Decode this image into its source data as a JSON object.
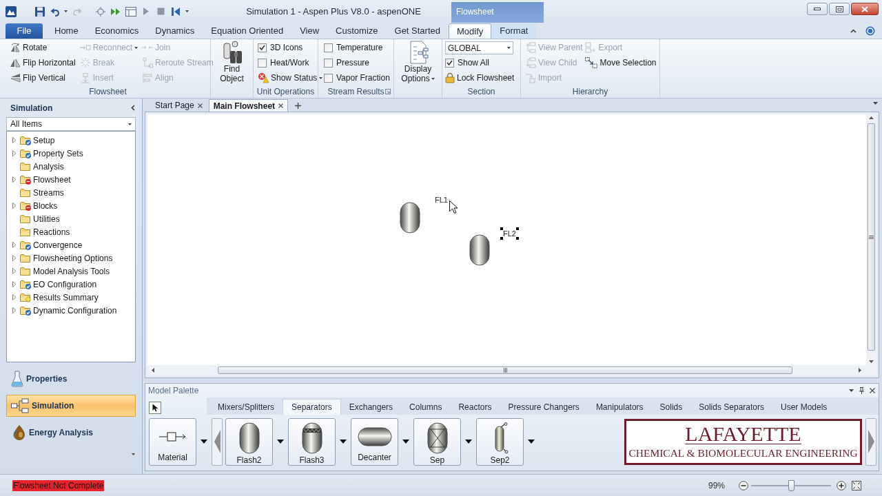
{
  "window": {
    "title": "Simulation 1 - Aspen Plus V8.0 - aspenONE",
    "context_tab": "Flowsheet"
  },
  "ribbon_tabs": [
    {
      "label": "File",
      "kind": "file",
      "selected": false
    },
    {
      "label": "Home",
      "kind": "tab",
      "selected": false
    },
    {
      "label": "Economics",
      "kind": "tab",
      "selected": false
    },
    {
      "label": "Dynamics",
      "kind": "tab",
      "selected": false
    },
    {
      "label": "Equation Oriented",
      "kind": "tab",
      "selected": false
    },
    {
      "label": "View",
      "kind": "tab",
      "selected": false
    },
    {
      "label": "Customize",
      "kind": "tab",
      "selected": false
    },
    {
      "label": "Get Started",
      "kind": "tab",
      "selected": false
    },
    {
      "label": "Modify",
      "kind": "context",
      "selected": true
    },
    {
      "label": "Format",
      "kind": "context",
      "selected": false
    }
  ],
  "ribbon_groups": [
    {
      "title": "Flowsheet",
      "columns": [
        [
          {
            "kind": "button",
            "label": "Rotate",
            "disabled": false
          },
          {
            "kind": "button",
            "label": "Flip Horizontal",
            "disabled": false
          },
          {
            "kind": "button",
            "label": "Flip Vertical",
            "disabled": false
          }
        ],
        [
          {
            "kind": "button",
            "label": "Reconnect",
            "disabled": true,
            "dropdown": true
          },
          {
            "kind": "button",
            "label": "Break",
            "disabled": true
          },
          {
            "kind": "button",
            "label": "Insert",
            "disabled": true
          }
        ],
        [
          {
            "kind": "button",
            "label": "Join",
            "disabled": true
          },
          {
            "kind": "button",
            "label": "Reroute Stream",
            "disabled": true
          },
          {
            "kind": "button",
            "label": "Align",
            "disabled": true
          }
        ]
      ]
    },
    {
      "columns": [
        [
          {
            "kind": "large",
            "label": "Find Object",
            "disabled": false
          }
        ]
      ]
    },
    {
      "title": "Unit Operations",
      "columns": [
        [
          {
            "kind": "checkbox",
            "label": "3D Icons",
            "checked": true
          },
          {
            "kind": "checkbox",
            "label": "Heat/Work",
            "checked": false
          },
          {
            "kind": "button",
            "label": "Show Status",
            "disabled": false,
            "dropdown": true
          }
        ]
      ]
    },
    {
      "title": "Stream Results",
      "launcher": true,
      "columns": [
        [
          {
            "kind": "checkbox",
            "label": "Temperature",
            "checked": false
          },
          {
            "kind": "checkbox",
            "label": "Pressure",
            "checked": false
          },
          {
            "kind": "checkbox",
            "label": "Vapor Fraction",
            "checked": false
          }
        ]
      ]
    },
    {
      "columns": [
        [
          {
            "kind": "large",
            "label": "Display Options",
            "disabled": false,
            "dropdown": true
          }
        ]
      ]
    },
    {
      "title": "Section",
      "columns": [
        [
          {
            "kind": "select",
            "value": "GLOBAL"
          },
          {
            "kind": "checkbox",
            "label": "Show All",
            "checked": true
          },
          {
            "kind": "button",
            "label": "Lock Flowsheet",
            "disabled": false
          }
        ]
      ]
    },
    {
      "title": "Hierarchy",
      "columns": [
        [
          {
            "kind": "button",
            "label": "View Parent",
            "disabled": true
          },
          {
            "kind": "button",
            "label": "View Child",
            "disabled": true
          },
          {
            "kind": "button",
            "label": "Import",
            "disabled": true
          }
        ],
        [
          {
            "kind": "button",
            "label": "Export",
            "disabled": true
          },
          {
            "kind": "button",
            "label": "Move Selection",
            "disabled": false
          }
        ]
      ]
    }
  ],
  "navigator": {
    "title": "Simulation",
    "filter": "All Items",
    "tree": [
      {
        "label": "Setup",
        "kind": "complete",
        "expanded": false
      },
      {
        "label": "Property Sets",
        "kind": "complete",
        "expanded": false
      },
      {
        "label": "Analysis",
        "kind": "plain"
      },
      {
        "label": "Flowsheet",
        "kind": "incomplete",
        "expanded": false
      },
      {
        "label": "Streams",
        "kind": "plain"
      },
      {
        "label": "Blocks",
        "kind": "incomplete",
        "expanded": false
      },
      {
        "label": "Utilities",
        "kind": "plain"
      },
      {
        "label": "Reactions",
        "kind": "plain"
      },
      {
        "label": "Convergence",
        "kind": "complete",
        "expanded": false
      },
      {
        "label": "Flowsheeting Options",
        "kind": "plain",
        "expanded": false
      },
      {
        "label": "Model Analysis Tools",
        "kind": "plain",
        "expanded": false
      },
      {
        "label": "EO Configuration",
        "kind": "complete",
        "expanded": false
      },
      {
        "label": "Results Summary",
        "kind": "results",
        "expanded": false
      },
      {
        "label": "Dynamic Configuration",
        "kind": "complete",
        "expanded": false
      }
    ]
  },
  "nav_buttons": [
    {
      "label": "Properties",
      "selected": false
    },
    {
      "label": "Simulation",
      "selected": true
    },
    {
      "label": "Energy Analysis",
      "selected": false
    }
  ],
  "document_tabs": [
    {
      "label": "Start Page",
      "selected": false
    },
    {
      "label": "Main Flowsheet",
      "selected": true
    }
  ],
  "flowsheet": {
    "blocks": [
      {
        "label": "FL1",
        "selected": false
      },
      {
        "label": "FL2",
        "selected": true
      }
    ]
  },
  "model_palette": {
    "title": "Model Palette",
    "tabs": [
      {
        "label": "Mixers/Splitters",
        "selected": false
      },
      {
        "label": "Separators",
        "selected": true
      },
      {
        "label": "Exchangers",
        "selected": false
      },
      {
        "label": "Columns",
        "selected": false
      },
      {
        "label": "Reactors",
        "selected": false
      },
      {
        "label": "Pressure Changers",
        "selected": false
      },
      {
        "label": "Manipulators",
        "selected": false
      },
      {
        "label": "Solids",
        "selected": false
      },
      {
        "label": "Solids Separators",
        "selected": false
      },
      {
        "label": "User Models",
        "selected": false
      }
    ],
    "models": [
      {
        "label": "Material",
        "kind": "stream"
      },
      {
        "label": "Flash2",
        "kind": "flash2"
      },
      {
        "label": "Flash3",
        "kind": "flash3"
      },
      {
        "label": "Decanter",
        "kind": "decanter"
      },
      {
        "label": "Sep",
        "kind": "sep"
      },
      {
        "label": "Sep2",
        "kind": "sep2"
      }
    ]
  },
  "logo": {
    "title": "LAFAYETTE",
    "subtitle": "CHEMICAL & BIOMOLECULAR ENGINEERING"
  },
  "status_bar": {
    "message": "Flowsheet Not Complete",
    "zoom": "99%",
    "zoom_slider": {
      "level": 0.5
    }
  }
}
